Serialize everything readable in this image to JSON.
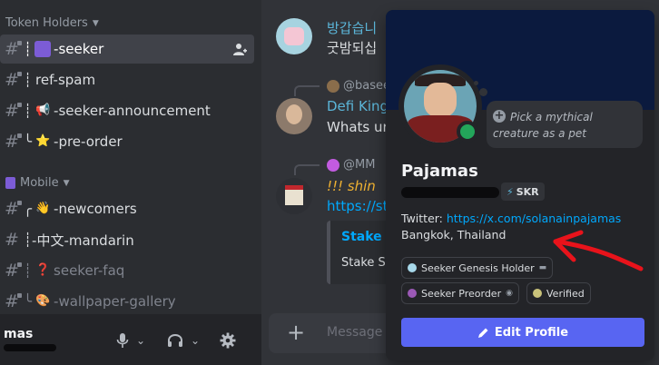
{
  "sidebar": {
    "categories": [
      {
        "label": "Token Holders"
      },
      {
        "label": "Mobile"
      }
    ],
    "channels": [
      {
        "prefix": "┊",
        "emoji": "📱",
        "name": "-seeker"
      },
      {
        "prefix": "┊",
        "emoji": "",
        "name": "ref-spam"
      },
      {
        "prefix": "┊",
        "emoji": "📢",
        "name": "-seeker-announcement"
      },
      {
        "prefix": "╰",
        "emoji": "⭐",
        "name": "-pre-order"
      },
      {
        "prefix": "╭",
        "emoji": "👋",
        "name": "-newcomers"
      },
      {
        "prefix": "┊",
        "emoji": "",
        "name": "-中文-mandarin"
      },
      {
        "prefix": "┊",
        "emoji": "❓",
        "name": "seeker-faq"
      },
      {
        "prefix": "╰",
        "emoji": "🎨",
        "name": "-wallpaper-gallery"
      }
    ],
    "user": {
      "name": "mas"
    }
  },
  "chat": {
    "messages": [
      {
        "line1": "방갑습니",
        "line2": "굿밤되십"
      },
      {
        "reply_user": "@basee",
        "author": "Defi King",
        "text": "Whats ur a"
      },
      {
        "reply_user": "@MM",
        "text": "!!! shin",
        "link": "https://st"
      }
    ],
    "embed": {
      "title": "Stake S",
      "text": "Stake SK"
    },
    "composer_placeholder": "Message #"
  },
  "profile": {
    "status_text": "Pick a mythical creature as a pet",
    "display_name": "Pajamas",
    "tag": "SKR",
    "twitter_label": "Twitter:",
    "twitter_url": "https://x.com/solanainpajamas",
    "location": "Bangkok, Thailand",
    "roles": [
      {
        "name": "Seeker Genesis Holder",
        "color": "#a7d8ea"
      },
      {
        "name": "Seeker Preorder",
        "color": "#9b59b6"
      },
      {
        "name": "Verified",
        "color": "#c9c27a"
      }
    ],
    "edit_button": "Edit Profile"
  },
  "icons": [
    "hash-icon",
    "add-member-icon",
    "microphone-icon",
    "headphones-icon",
    "gear-icon",
    "plus-icon",
    "pencil-icon",
    "smile-plus-icon",
    "chevron-down-icon"
  ],
  "colors": {
    "accent": "#5865f2",
    "online": "#23a55a",
    "link": "#00a8fc",
    "annotation_arrow": "#e8131b"
  }
}
